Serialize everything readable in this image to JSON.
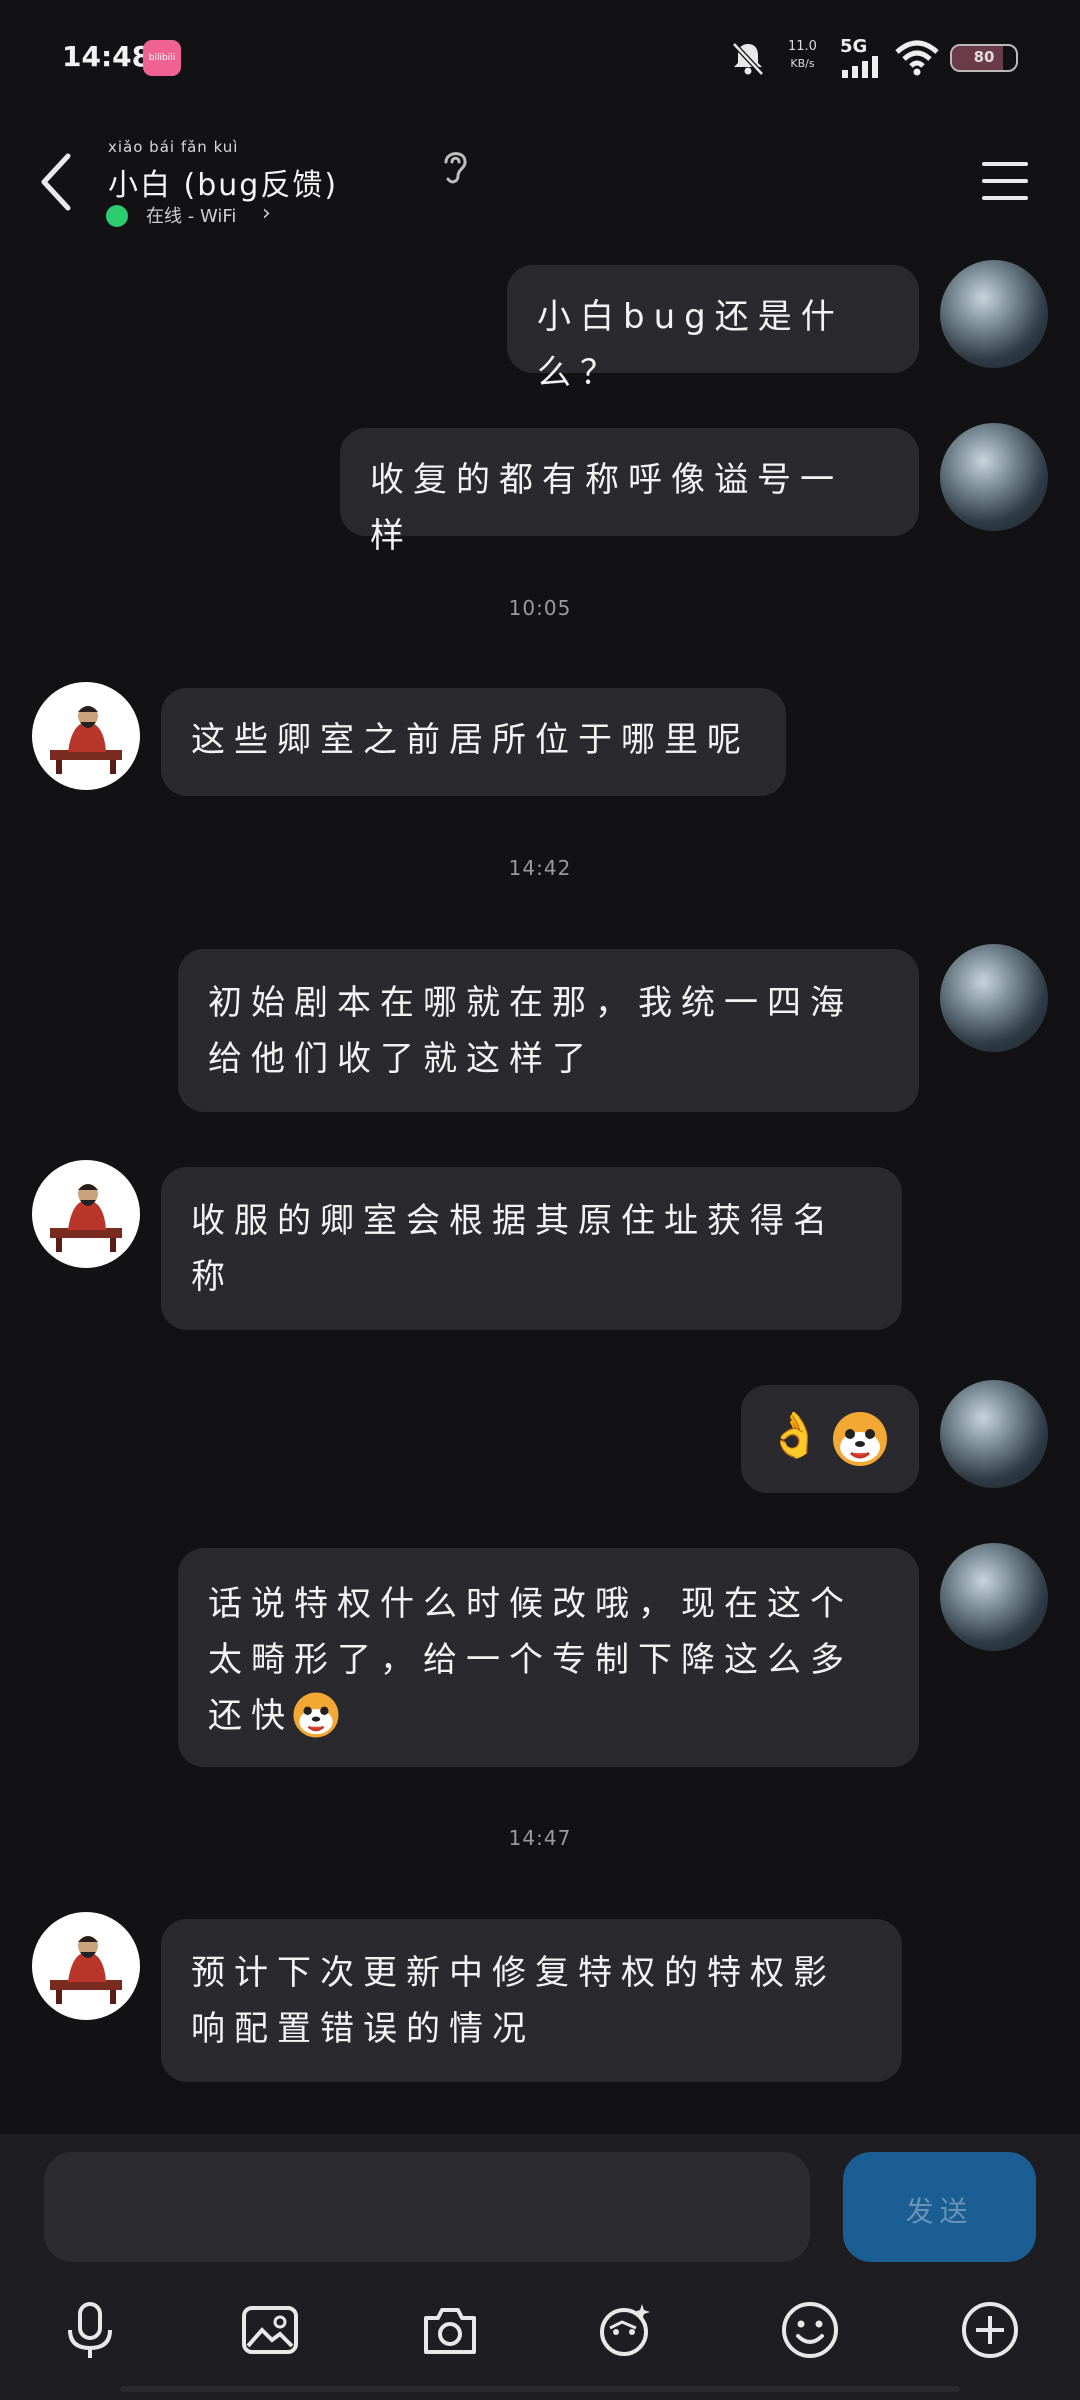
{
  "status_bar": {
    "time": "14:48",
    "app_logo_text": "bilibili",
    "net_speed": "11.0",
    "net_unit": "KB/s",
    "network": "5G",
    "battery": "80"
  },
  "header": {
    "title": "小白 (bug反馈)",
    "title_pinyin": "xiǎo bái    fǎn kuì",
    "online": "在线 - WiFi"
  },
  "timestamps": [
    "10:05",
    "14:42",
    "14:47"
  ],
  "messages": [
    {
      "from": "self",
      "text": "小白bug还是什么？"
    },
    {
      "from": "self",
      "text": "收复的都有称呼像谥号一样"
    },
    {
      "from": "other",
      "text": "这些卿室之前居所位于哪里呢"
    },
    {
      "from": "self",
      "text": "初始剧本在哪就在那，我统一四海\n给他们收了就这样了"
    },
    {
      "from": "other",
      "text": "收服的卿室会根据其原住址获得名\n称"
    },
    {
      "from": "self",
      "text": "👌"
    },
    {
      "from": "self",
      "text": "话说特权什么时候改哦，现在这个\n太畸形了，给一个专制下降这么多\n还快"
    },
    {
      "from": "other",
      "text": "预计下次更新中修复特权的特权影\n响配置错误的情况"
    }
  ],
  "input": {
    "placeholder": "",
    "send_label": "发送"
  },
  "toolbar": [
    "microphone-icon",
    "image-icon",
    "camera-icon",
    "sticker-icon",
    "emoji-icon",
    "plus-icon"
  ]
}
